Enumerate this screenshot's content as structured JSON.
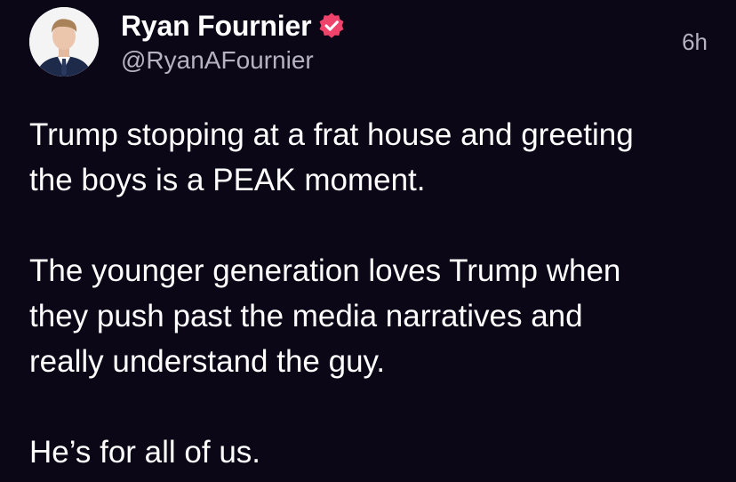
{
  "post": {
    "author": {
      "display_name": "Ryan Fournier",
      "handle": "@RyanAFournier",
      "verified": true,
      "badge_color": "#f0436c",
      "avatar_icon": "profile-photo"
    },
    "timestamp": "6h",
    "paragraphs": [
      "Trump stopping at a frat house and greeting\nthe boys is a PEAK moment.",
      "The younger generation loves Trump when\nthey push past the media narratives and\nreally understand the guy.",
      "He’s for all of us."
    ]
  },
  "theme": {
    "background": "#0b0717",
    "primary_text": "#ffffff",
    "secondary_text": "#b6b2c2"
  }
}
